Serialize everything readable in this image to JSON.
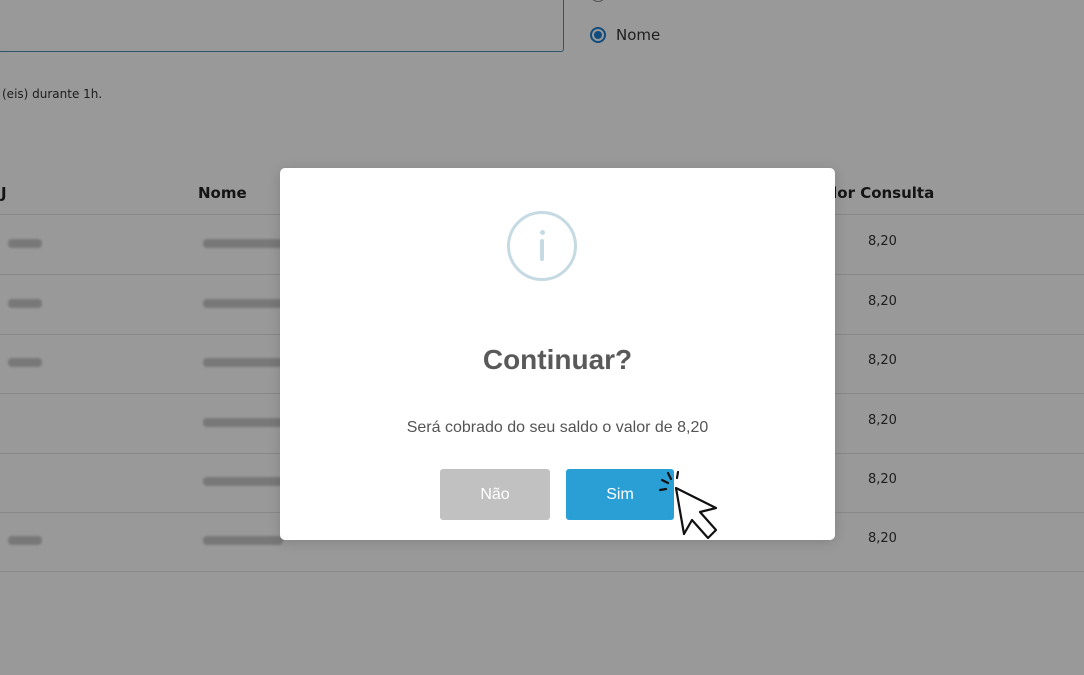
{
  "search": {
    "value": ""
  },
  "radio_options": [
    {
      "label": "Nome",
      "checked": true
    }
  ],
  "note_text": "(eis) durante 1h.",
  "table": {
    "headers": {
      "doc": "J",
      "nome": "Nome",
      "valor": "alor Consulta"
    },
    "rows": [
      {
        "valor": "8,20"
      },
      {
        "valor": "8,20"
      },
      {
        "valor": "8,20"
      },
      {
        "valor": "8,20"
      },
      {
        "valor": "8,20"
      },
      {
        "valor": "8,20"
      }
    ]
  },
  "modal": {
    "icon": "info-icon",
    "title": "Continuar?",
    "text": "Será cobrado do seu saldo o valor de 8,20",
    "cancel_label": "Não",
    "confirm_label": "Sim"
  },
  "colors": {
    "confirm": "#2a9fd6",
    "cancel": "#c1c1c1",
    "icon": "#c5dae2",
    "overlay": "rgba(0,0,0,0.40)"
  }
}
